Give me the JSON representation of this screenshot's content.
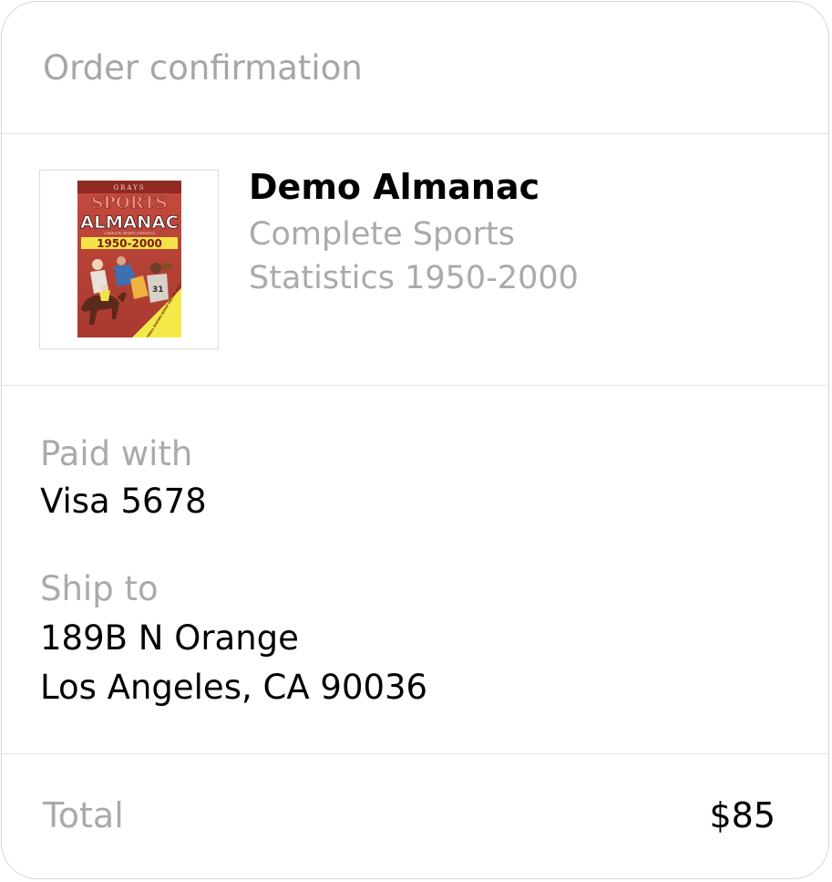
{
  "header": {
    "title": "Order confirmation"
  },
  "product": {
    "name": "Demo Almanac",
    "description": "Complete Sports Statistics 1950-2000",
    "cover": {
      "publisher": "GRAYS",
      "title_top": "SPORTS",
      "title_main": "ALMANAC",
      "subtitle": "COMPLETE SPORTS STATISTICS",
      "years": "1950-2000",
      "banner": "BASEBALL FOOTBALL BOXING HORSE RACING AND MORE!"
    }
  },
  "payment": {
    "label": "Paid with",
    "value": "Visa 5678"
  },
  "shipping": {
    "label": "Ship to",
    "line1": "189B N Orange",
    "line2": "Los Angeles, CA 90036"
  },
  "total": {
    "label": "Total",
    "value": "$85"
  }
}
